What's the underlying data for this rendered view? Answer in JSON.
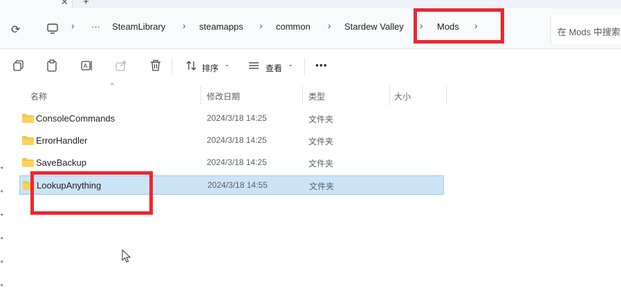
{
  "tabs": {
    "close_label": "✕",
    "new_tab_label": "+"
  },
  "address_bar": {
    "refresh_label": "⟳",
    "more_label": "···",
    "separator": "›",
    "breadcrumbs": [
      "SteamLibrary",
      "steamapps",
      "common",
      "Stardew Valley",
      "Mods"
    ],
    "search_placeholder": "在 Mods 中搜索"
  },
  "toolbar": {
    "sort_label": "排序",
    "view_label": "查看",
    "more_label": "•••"
  },
  "columns": {
    "name": "名称",
    "modified": "修改日期",
    "type": "类型",
    "size": "大小"
  },
  "rows": [
    {
      "name": "ConsoleCommands",
      "date": "2024/3/18 14:25",
      "type": "文件夹",
      "selected": false
    },
    {
      "name": "ErrorHandler",
      "date": "2024/3/18 14:25",
      "type": "文件夹",
      "selected": false
    },
    {
      "name": "SaveBackup",
      "date": "2024/3/18 14:25",
      "type": "文件夹",
      "selected": false
    },
    {
      "name": "LookupAnything",
      "date": "2024/3/18 14:55",
      "type": "文件夹",
      "selected": true
    }
  ],
  "colors": {
    "selection": "#cce4f7",
    "highlight_box": "#ee2630",
    "folder": "#f6c443"
  },
  "icons": [
    "refresh-icon",
    "computer-icon",
    "copy-icon",
    "paste-icon",
    "rename-icon",
    "share-icon",
    "delete-icon",
    "sort-icon",
    "view-icon",
    "folder-icon",
    "mouse-cursor-icon"
  ]
}
